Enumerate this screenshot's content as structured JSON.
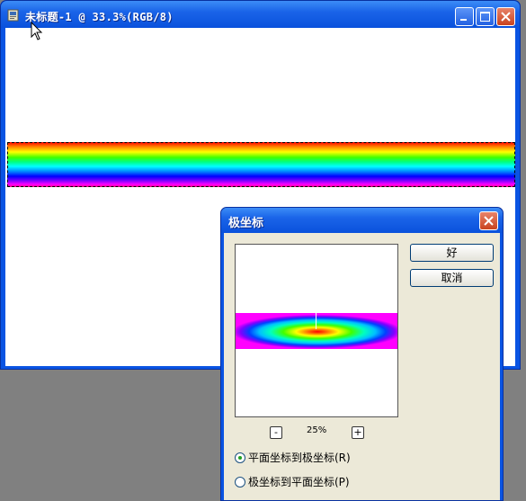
{
  "document_window": {
    "title": "未标题-1 @ 33.3%(RGB/8)",
    "app_icon": "photoshop-document-icon",
    "controls": [
      "minimize-icon",
      "maximize-icon",
      "close-icon"
    ]
  },
  "dialog": {
    "title": "极坐标",
    "ok_label": "好",
    "cancel_label": "取消",
    "zoom": {
      "minus": "-",
      "value": "25%",
      "plus": "+"
    },
    "options": [
      {
        "label": "平面坐标到极坐标(R)",
        "checked": true
      },
      {
        "label": "极坐标到平面坐标(P)",
        "checked": false
      }
    ]
  },
  "colors": {
    "titlebar": "#0a54e3",
    "dialog_bg": "#ece9d8",
    "workspace": "#808080"
  }
}
